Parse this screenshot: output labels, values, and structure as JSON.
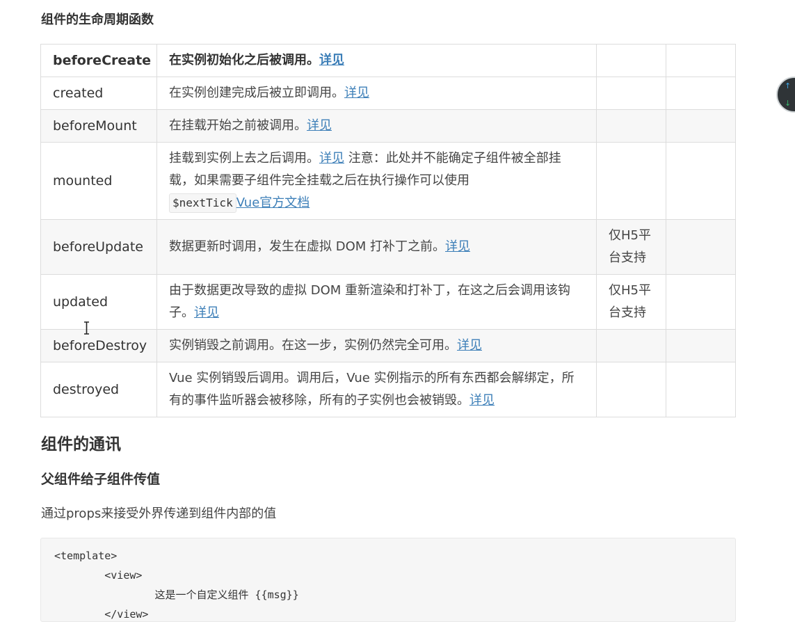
{
  "lifecycle_heading": "组件的生命周期函数",
  "rows": [
    {
      "name": "beforeCreate",
      "desc_parts": [
        "在实例初始化之后被调用。"
      ],
      "link": "详见",
      "platform": ""
    },
    {
      "name": "created",
      "desc_parts": [
        "在实例创建完成后被立即调用。"
      ],
      "link": "详见",
      "platform": ""
    },
    {
      "name": "beforeMount",
      "desc_parts": [
        "在挂载开始之前被调用。"
      ],
      "link": "详见",
      "platform": ""
    },
    {
      "name": "mounted",
      "desc_before": "挂载到实例上去之后调用。",
      "link": "详见",
      "desc_after": " 注意：此处并不能确定子组件被全部挂载，如果需要子组件完全挂载之后在执行操作可以使用",
      "code": "$nextTick",
      "link2": "Vue官方文档",
      "platform": ""
    },
    {
      "name": "beforeUpdate",
      "desc_parts": [
        "数据更新时调用，发生在虚拟 DOM 打补丁之前。"
      ],
      "link": "详见",
      "platform": "仅H5平台支持"
    },
    {
      "name": "updated",
      "desc_parts": [
        "由于数据更改导致的虚拟 DOM 重新渲染和打补丁，在这之后会调用该钩子。"
      ],
      "link": "详见",
      "platform": "仅H5平台支持"
    },
    {
      "name": "beforeDestroy",
      "desc_parts": [
        "实例销毁之前调用。在这一步，实例仍然完全可用。"
      ],
      "link": "详见",
      "platform": ""
    },
    {
      "name": "destroyed",
      "desc_parts": [
        "Vue 实例销毁后调用。调用后，Vue 实例指示的所有东西都会解绑定，所有的事件监听器会被移除，所有的子实例也会被销毁。"
      ],
      "link": "详见",
      "platform": ""
    }
  ],
  "communication_heading": "组件的通讯",
  "parent_to_child_heading": "父组件给子组件传值",
  "props_paragraph": "通过props来接受外界传递到组件内部的值",
  "code_lines": [
    "<template>",
    "        <view>",
    "                这是一个自定义组件 {{msg}}",
    "        </view>"
  ],
  "colors": {
    "link": "#3d7fb8",
    "row_alt_bg": "#f7f7f7",
    "border": "#dcdcdc",
    "code_bg": "#f6f6f6"
  },
  "icons": {
    "float_nav": [
      "arrow-up-icon",
      "arrow-down-icon"
    ]
  }
}
